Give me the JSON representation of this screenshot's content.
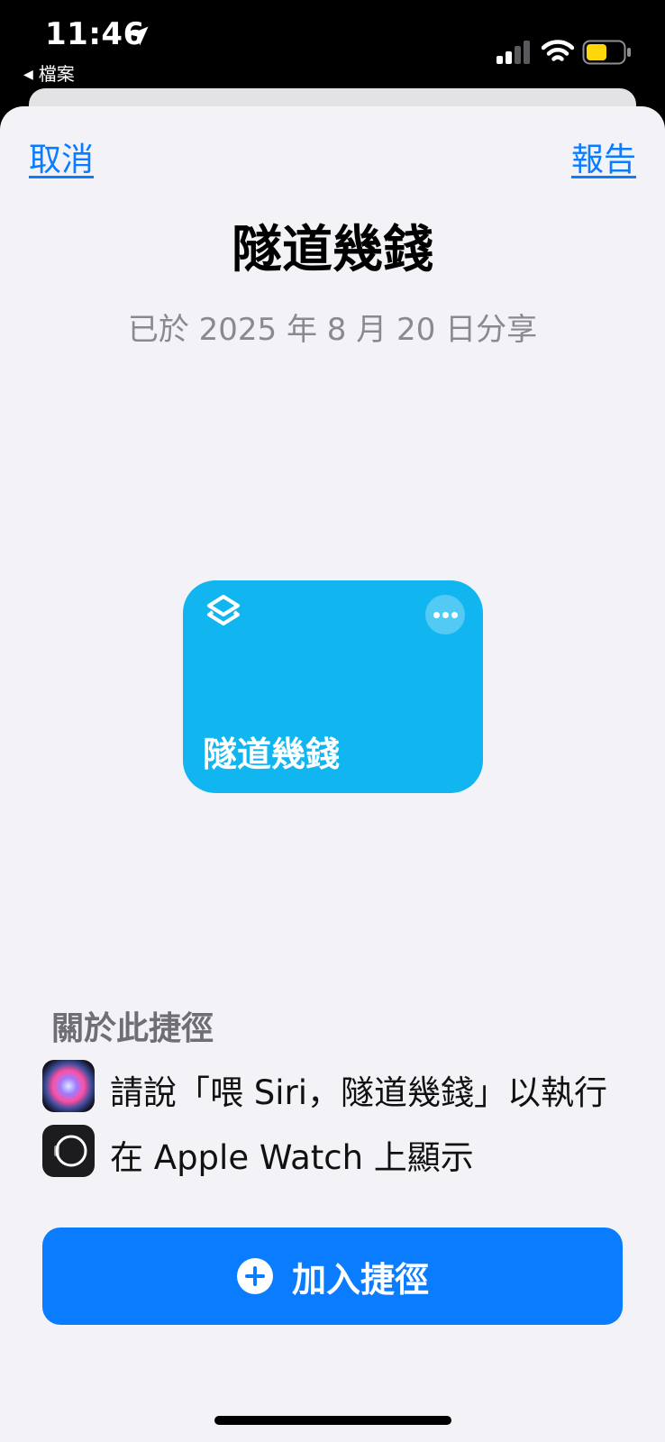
{
  "status_bar": {
    "time": "11:46",
    "back_app": "檔案",
    "icons": [
      "location-arrow-icon",
      "cellular-signal-icon",
      "wifi-icon",
      "battery-icon"
    ],
    "battery_color": "#ffd60a"
  },
  "nav": {
    "cancel": "取消",
    "report": "報告"
  },
  "shortcut": {
    "title": "隧道幾錢",
    "shared_date": "已於 2025 年 8 月 20 日分享",
    "card_title": "隧道幾錢",
    "card_color": "#11b6f0",
    "card_icon": "shortcuts-layers-icon",
    "more_icon": "more-ellipsis-icon"
  },
  "about": {
    "header": "關於此捷徑",
    "items": [
      {
        "icon": "siri-icon",
        "text": "請說「喂 Siri，隧道幾錢」以執行"
      },
      {
        "icon": "apple-watch-icon",
        "text": "在 Apple Watch 上顯示"
      }
    ]
  },
  "add_button": {
    "label": "加入捷徑",
    "icon": "plus-circle-icon",
    "color": "#0a7cff"
  }
}
